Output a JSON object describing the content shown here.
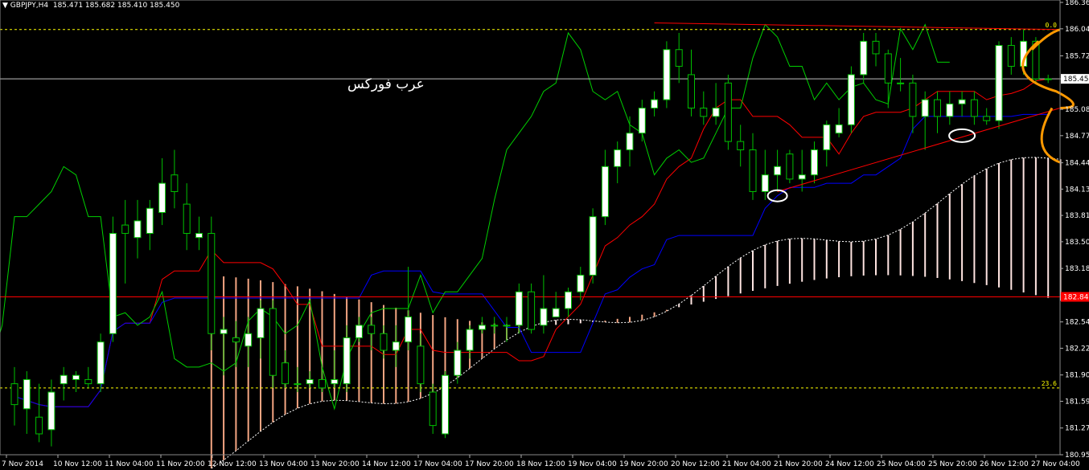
{
  "header": {
    "symbol": "GBPJPY,H4",
    "quote": "185.471 185.682 185.410 185.450"
  },
  "watermark": "عرب فوركس",
  "colors": {
    "background": "#000000",
    "candle_up": "#ffffff",
    "candle_down": "#000000",
    "wick": "#00c000",
    "tenkan": "#ff0000",
    "kijun": "#0000ff",
    "chikou": "#00d000",
    "kumo_hatch": "#f4a582",
    "kumo_hatch_b": "#ffe4e1",
    "trendline": "#ff0000",
    "level_line": "#ffff00",
    "arrow": "#ff9900",
    "price_marker_bg": "#ff0000",
    "bid_marker_bg": "#ffffff"
  },
  "chart_data": {
    "type": "candlestick",
    "title": "GBPJPY,H4",
    "ylim": [
      180.95,
      186.365
    ],
    "y_ticks": [
      "186.365",
      "186.049",
      "185.725",
      "185.450",
      "185.085",
      "184.770",
      "184.445",
      "184.130",
      "183.815",
      "183.500",
      "183.180",
      "182.865",
      "182.540",
      "182.225",
      "181.905",
      "181.590",
      "181.270",
      "180.950"
    ],
    "x_ticks": [
      "7 Nov 2014",
      "10 Nov 12:00",
      "11 Nov 04:00",
      "11 Nov 20:00",
      "12 Nov 12:00",
      "13 Nov 04:00",
      "13 Nov 20:00",
      "14 Nov 12:00",
      "17 Nov 04:00",
      "17 Nov 20:00",
      "18 Nov 12:00",
      "19 Nov 04:00",
      "19 Nov 20:00",
      "20 Nov 12:00",
      "21 Nov 04:00",
      "21 Nov 20:00",
      "24 Nov 12:00",
      "25 Nov 04:00",
      "25 Nov 20:00",
      "26 Nov 12:00",
      "27 Nov 04:00"
    ],
    "levels": [
      {
        "label": "0.0",
        "value": 186.04,
        "style": "dashed"
      },
      {
        "label": "23.6",
        "value": 181.75,
        "style": "dashed"
      },
      {
        "label": "182.84",
        "value": 182.84,
        "style": "solid"
      },
      {
        "label": "185.450",
        "value": 185.45,
        "style": "solid"
      }
    ],
    "candles": [
      [
        181.8,
        181.55,
        182.0,
        181.3
      ],
      [
        181.5,
        181.85,
        181.95,
        181.2
      ],
      [
        181.4,
        181.2,
        181.8,
        181.1
      ],
      [
        181.25,
        181.7,
        181.85,
        181.05
      ],
      [
        181.8,
        181.9,
        182.0,
        181.6
      ],
      [
        181.85,
        181.9,
        181.95,
        181.7
      ],
      [
        181.85,
        181.8,
        182.0,
        181.75
      ],
      [
        181.8,
        182.3,
        182.4,
        181.7
      ],
      [
        182.4,
        183.6,
        183.8,
        182.3
      ],
      [
        183.7,
        183.6,
        184.0,
        183.0
      ],
      [
        183.55,
        183.75,
        184.0,
        183.3
      ],
      [
        183.6,
        183.9,
        184.0,
        183.4
      ],
      [
        183.85,
        184.2,
        184.5,
        183.7
      ],
      [
        184.3,
        184.1,
        184.6,
        183.9
      ],
      [
        183.95,
        183.6,
        184.2,
        183.4
      ],
      [
        183.55,
        183.6,
        183.8,
        183.4
      ],
      [
        183.6,
        182.4,
        183.8,
        182.2
      ],
      [
        182.4,
        182.45,
        182.6,
        181.9
      ],
      [
        182.35,
        182.3,
        182.55,
        182.0
      ],
      [
        182.25,
        182.4,
        182.6,
        182.0
      ],
      [
        182.35,
        182.7,
        182.8,
        182.1
      ],
      [
        182.7,
        181.9,
        182.8,
        181.75
      ],
      [
        182.05,
        181.8,
        182.2,
        181.75
      ],
      [
        181.8,
        181.8,
        182.0,
        181.7
      ],
      [
        181.8,
        181.85,
        181.95,
        181.75
      ],
      [
        181.85,
        181.75,
        182.0,
        181.7
      ],
      [
        181.8,
        181.85,
        182.2,
        181.75
      ],
      [
        181.8,
        182.35,
        182.5,
        181.7
      ],
      [
        182.35,
        182.5,
        182.6,
        182.3
      ],
      [
        182.5,
        182.4,
        182.6,
        182.2
      ],
      [
        182.4,
        182.2,
        182.5,
        182.1
      ],
      [
        182.2,
        182.3,
        182.5,
        182.0
      ],
      [
        182.3,
        182.6,
        183.2,
        182.2
      ],
      [
        182.25,
        181.8,
        182.4,
        181.7
      ],
      [
        181.7,
        181.3,
        181.8,
        181.2
      ],
      [
        181.2,
        181.9,
        181.95,
        181.15
      ],
      [
        181.9,
        182.2,
        182.3,
        181.8
      ],
      [
        182.2,
        182.45,
        182.5,
        182.1
      ],
      [
        182.45,
        182.5,
        182.6,
        182.4
      ],
      [
        182.5,
        182.5,
        182.6,
        182.4
      ],
      [
        182.5,
        182.5,
        182.6,
        182.3
      ],
      [
        182.5,
        182.9,
        183.0,
        182.4
      ],
      [
        182.9,
        182.45,
        183.0,
        182.4
      ],
      [
        182.5,
        182.7,
        183.1,
        182.4
      ],
      [
        182.6,
        182.7,
        182.9,
        182.6
      ],
      [
        182.7,
        182.9,
        182.95,
        182.6
      ],
      [
        182.9,
        183.1,
        183.2,
        182.8
      ],
      [
        183.1,
        183.8,
        183.9,
        183.0
      ],
      [
        183.8,
        184.4,
        184.6,
        183.7
      ],
      [
        184.4,
        184.6,
        184.7,
        184.2
      ],
      [
        184.6,
        184.8,
        185.0,
        184.4
      ],
      [
        184.8,
        185.1,
        185.2,
        184.7
      ],
      [
        185.1,
        185.2,
        185.3,
        185.0
      ],
      [
        185.2,
        185.8,
        185.9,
        185.1
      ],
      [
        185.8,
        185.6,
        186.0,
        185.4
      ],
      [
        185.5,
        185.1,
        185.8,
        185.0
      ],
      [
        185.1,
        185.0,
        185.3,
        184.9
      ],
      [
        185.0,
        185.1,
        185.4,
        184.9
      ],
      [
        185.4,
        184.7,
        185.5,
        184.6
      ],
      [
        184.7,
        184.6,
        184.9,
        184.4
      ],
      [
        184.6,
        184.1,
        184.8,
        184.0
      ],
      [
        184.1,
        184.3,
        184.6,
        184.0
      ],
      [
        184.3,
        184.4,
        184.6,
        184.1
      ],
      [
        184.55,
        184.25,
        184.6,
        184.2
      ],
      [
        184.25,
        184.3,
        184.6,
        184.1
      ],
      [
        184.3,
        184.6,
        184.7,
        184.2
      ],
      [
        184.6,
        184.9,
        184.95,
        184.4
      ],
      [
        184.8,
        184.9,
        185.1,
        184.75
      ],
      [
        184.9,
        185.5,
        185.6,
        184.8
      ],
      [
        185.5,
        185.9,
        186.0,
        185.4
      ],
      [
        185.9,
        185.75,
        186.0,
        185.6
      ],
      [
        185.75,
        185.4,
        185.8,
        185.1
      ],
      [
        185.4,
        185.4,
        185.7,
        185.3
      ],
      [
        185.4,
        185.0,
        185.5,
        184.8
      ],
      [
        185.0,
        185.2,
        185.3,
        184.6
      ],
      [
        185.2,
        185.0,
        185.3,
        184.8
      ],
      [
        185.0,
        185.15,
        185.3,
        184.9
      ],
      [
        185.15,
        185.2,
        185.3,
        185.0
      ],
      [
        185.2,
        185.0,
        185.3,
        184.9
      ],
      [
        185.0,
        184.95,
        185.1,
        184.9
      ],
      [
        184.95,
        185.85,
        185.9,
        184.85
      ],
      [
        185.85,
        185.6,
        185.95,
        185.5
      ],
      [
        185.6,
        185.9,
        186.05,
        185.5
      ],
      [
        185.9,
        185.45,
        185.95,
        185.4
      ],
      [
        185.45,
        185.45,
        185.5,
        185.4
      ]
    ]
  }
}
